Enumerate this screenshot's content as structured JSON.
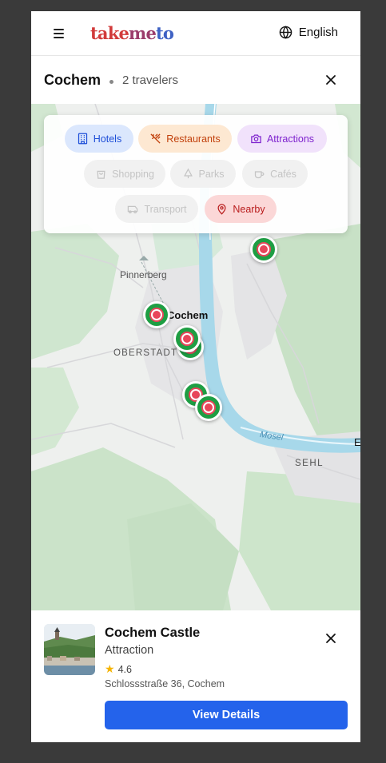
{
  "header": {
    "logo": {
      "part1": "take",
      "part2": "me",
      "part3": "to"
    },
    "language": "English"
  },
  "trip": {
    "city": "Cochem",
    "travelers": "2 travelers"
  },
  "filters": [
    {
      "label": "Hotels",
      "icon": "building-icon",
      "active": true,
      "color": "#1d4ed8",
      "bg": "#dbe7fd"
    },
    {
      "label": "Restaurants",
      "icon": "utensils-icon",
      "active": true,
      "color": "#c2410c",
      "bg": "#fde8d2"
    },
    {
      "label": "Attractions",
      "icon": "camera-icon",
      "active": true,
      "color": "#7e22ce",
      "bg": "#f1e2fb"
    },
    {
      "label": "Shopping",
      "icon": "shopping-bag-icon",
      "active": false
    },
    {
      "label": "Parks",
      "icon": "tree-icon",
      "active": false
    },
    {
      "label": "Cafés",
      "icon": "coffee-icon",
      "active": false
    },
    {
      "label": "Transport",
      "icon": "bus-icon",
      "active": false
    },
    {
      "label": "Nearby",
      "icon": "map-pin-icon",
      "active": true,
      "color": "#b91c1c",
      "bg": "#fbd7d7"
    }
  ],
  "map": {
    "labels": {
      "pinnerberg": "Pinnerberg",
      "cochem": "Cochem",
      "oberstadt": "OBERSTADT",
      "mosel": "Mosel",
      "sehl": "SEHL",
      "edge": "E"
    }
  },
  "place": {
    "name": "Cochem Castle",
    "type": "Attraction",
    "rating": "4.6",
    "address": "Schlossstraße 36, Cochem",
    "button": "View Details"
  }
}
